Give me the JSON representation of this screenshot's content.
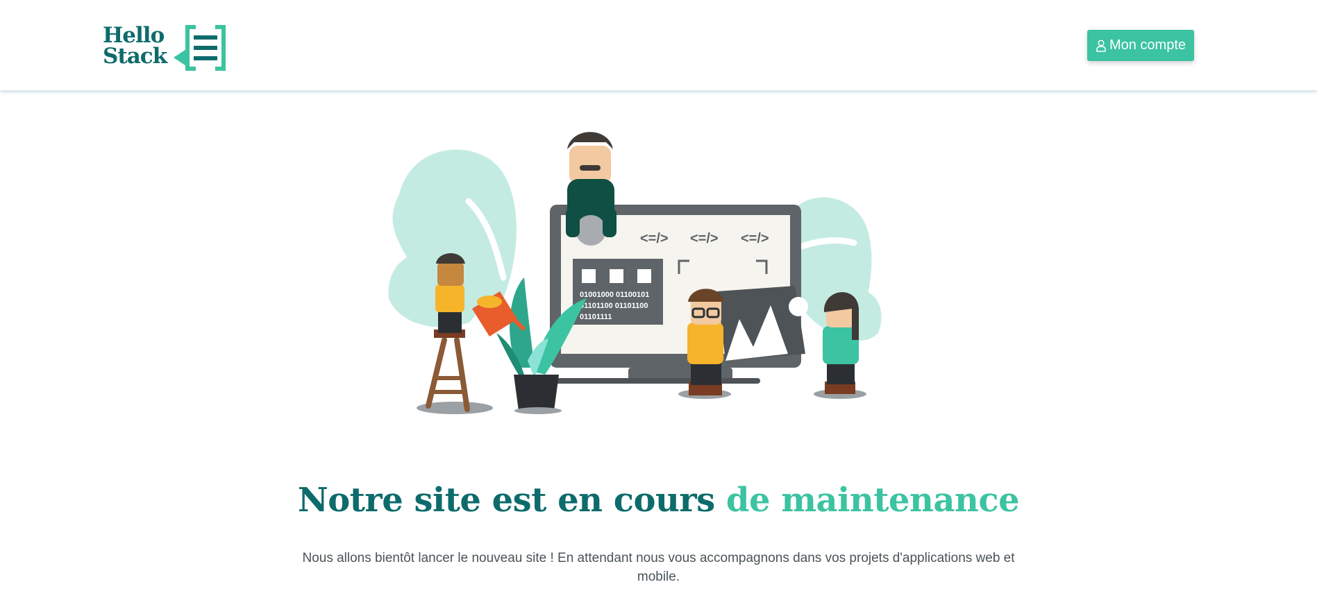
{
  "header": {
    "logo": {
      "line1": "Hello",
      "line2": "Stack"
    },
    "account_button": {
      "label": "Mon compte",
      "icon": "user-icon"
    }
  },
  "illustration": {
    "code_tags": [
      "<=/>",
      "<=/>",
      "<=/>"
    ],
    "binary_lines": [
      "01001000 01100101",
      "01101100 01101100",
      "01101111"
    ]
  },
  "main": {
    "title_part1": "Notre site est en cours ",
    "title_part2": "de maintenance",
    "description": "Nous allons bientôt lancer le nouveau site ! En attendant nous vous accompagnons dans vos projets d'applications web et mobile."
  },
  "colors": {
    "brand_dark": "#0e6b6b",
    "brand_accent": "#3cc3a1",
    "leaf_light": "#c4ebe2"
  }
}
